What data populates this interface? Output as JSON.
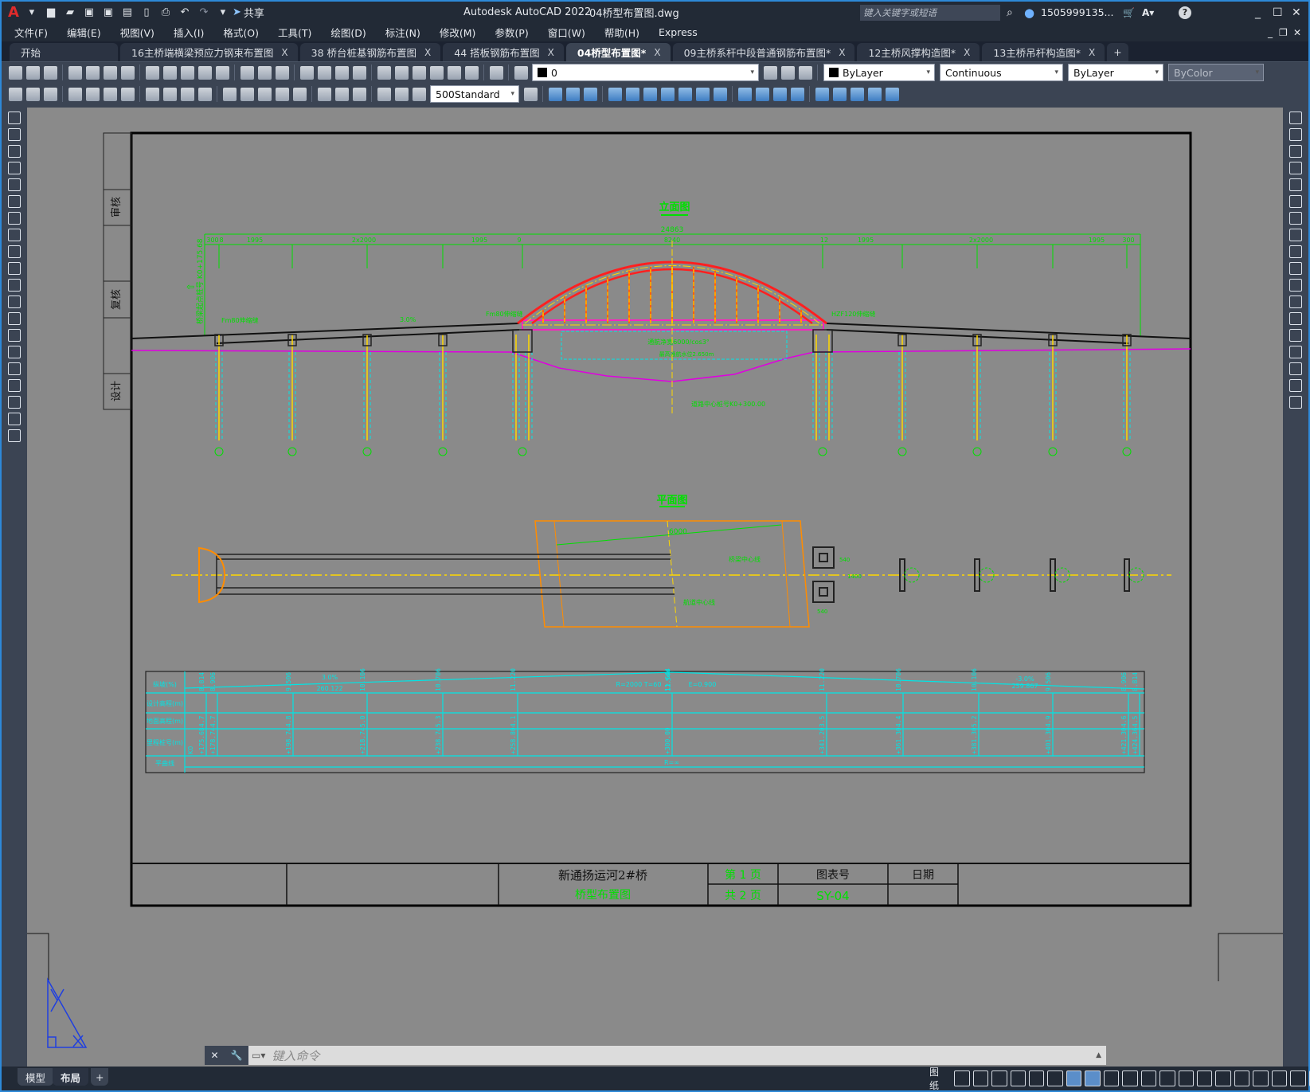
{
  "titlebar": {
    "app_icon": "A",
    "share": "共享",
    "app_name": "Autodesk AutoCAD 2022",
    "file": "04桥型布置图.dwg",
    "search_placeholder": "键入关键字或短语",
    "user": "1505999135...",
    "icons": [
      "new-icon",
      "open-icon",
      "save-icon",
      "saveas-icon",
      "plot-icon",
      "undo-icon",
      "redo-icon",
      "search-icon",
      "user-icon",
      "cart-icon",
      "autodesk-icon",
      "help-icon"
    ]
  },
  "menu": [
    "文件(F)",
    "编辑(E)",
    "视图(V)",
    "插入(I)",
    "格式(O)",
    "工具(T)",
    "绘图(D)",
    "标注(N)",
    "修改(M)",
    "参数(P)",
    "窗口(W)",
    "帮助(H)",
    "Express"
  ],
  "tabs": [
    {
      "label": "开始",
      "closable": false
    },
    {
      "label": "16主桥端横梁预应力钢束布置图",
      "closable": true
    },
    {
      "label": "38 桥台桩基钢筋布置图",
      "closable": true
    },
    {
      "label": "44 搭板钢筋布置图",
      "closable": true
    },
    {
      "label": "04桥型布置图*",
      "closable": true,
      "active": true
    },
    {
      "label": "09主桥系杆中段普通钢筋布置图*",
      "closable": true
    },
    {
      "label": "12主桥风撑构造图*",
      "closable": true
    },
    {
      "label": "13主桥吊杆构造图*",
      "closable": true
    }
  ],
  "tab_close": "X",
  "tab_add": "+",
  "toolbar": {
    "layer": "0",
    "color": "ByLayer",
    "linetype": "Continuous",
    "lineweight": "ByLayer",
    "plotstyle": "ByColor",
    "dimstyle": "500Standard"
  },
  "drawing": {
    "side_labels": [
      "审核",
      "复核",
      "设计"
    ],
    "elevation_title": "立面图",
    "plan_title": "平面图",
    "dim_total": "24863",
    "dims": [
      "300",
      "8",
      "1995",
      "2x2000",
      "1995",
      "9",
      "8240",
      "12",
      "1995",
      "2x2000",
      "1995",
      "300"
    ],
    "station_start": "桥梁起点桩号 K0+175.68",
    "joint_left": "Fm80伸缩缝",
    "joint_arch_left": "Fm80伸缩缝",
    "joint_arch_right": "HZF120伸缩缝",
    "slope_left": "3.0%",
    "clearance": "通航净宽6000/cos3°",
    "clear_height": "最高通航水位2.650m",
    "center_station": "道路中心桩号K0+300.00",
    "plan_bridge_axis": "桥梁中心线",
    "plan_channel_axis": "航道中心线",
    "plan_width": "6000",
    "pier_dims": [
      "540",
      "540",
      "1400",
      "540"
    ]
  },
  "profile_table": {
    "row_labels": [
      "纵坡(%)",
      "设计高程(m)",
      "地面高程(m)",
      "里程桩号(m)",
      "平曲线"
    ],
    "grade": {
      "left_slope": "3.0%",
      "left_len": "260.122",
      "curve": "R=2000   T=60",
      "top": "12.544",
      "e": "E=0.900",
      "right_slope": "-3.0%",
      "right_len": "259.867",
      "plan_curve": "R=∞",
      "k0": "K0"
    },
    "columns": [
      {
        "design": "8.814",
        "ground": "4.7",
        "station": "+175.68"
      },
      {
        "design": "8.906",
        "ground": "4.7",
        "station": "+178.74"
      },
      {
        "design": "9.506",
        "ground": "4.8",
        "station": "+198.74"
      },
      {
        "design": "10.106",
        "ground": "5.0",
        "station": "+218.74"
      },
      {
        "design": "10.706",
        "ground": "5.3",
        "station": "+238.74"
      },
      {
        "design": "11.220",
        "ground": "4.1",
        "station": "+258.80"
      },
      {
        "design": "11.644",
        "ground": "",
        "station": "+300.00"
      },
      {
        "design": "11.220",
        "ground": "3.5",
        "station": "+341.20"
      },
      {
        "design": "10.706",
        "ground": "4.4",
        "station": "+361.30"
      },
      {
        "design": "10.106",
        "ground": "5.2",
        "station": "+381.30"
      },
      {
        "design": "9.506",
        "ground": "4.9",
        "station": "+401.30"
      },
      {
        "design": "8.906",
        "ground": "4.6",
        "station": "+421.30"
      },
      {
        "design": "8.814",
        "ground": "4.5",
        "station": "+424.36"
      }
    ]
  },
  "title_block": {
    "project": "新通扬运河2#桥",
    "sheet_name": "桥型布置图",
    "page": "第 1 页",
    "total": "共 2 页",
    "drawing_no_label": "图表号",
    "drawing_no": "SY-04",
    "date_label": "日期"
  },
  "command": {
    "placeholder": "键入命令"
  },
  "layout_tabs": [
    "模型",
    "布局"
  ],
  "status": {
    "paper": "图纸"
  }
}
